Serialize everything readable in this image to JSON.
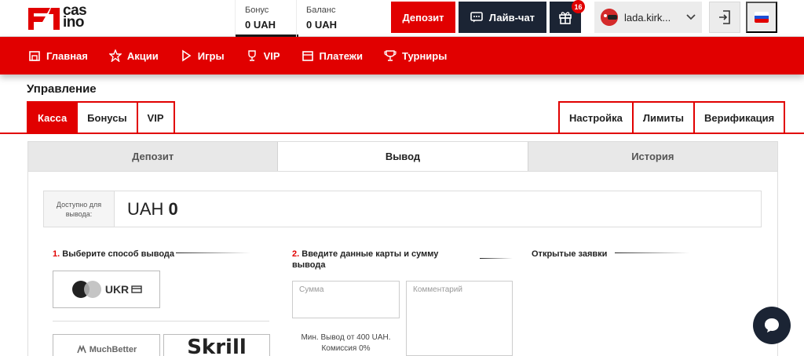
{
  "header": {
    "logo_text": "cas ino",
    "bonus": {
      "label": "Бонус",
      "value": "0 UAH"
    },
    "balance": {
      "label": "Баланс",
      "value": "0 UAH"
    },
    "deposit_label": "Депозит",
    "chat_label": "Лайв-чат",
    "gift_badge": "16",
    "username": "lada.kirk..."
  },
  "nav": {
    "items": [
      {
        "label": "Главная",
        "icon": "home-icon"
      },
      {
        "label": "Акции",
        "icon": "star-icon"
      },
      {
        "label": "Игры",
        "icon": "play-icon"
      },
      {
        "label": "VIP",
        "icon": "trophy-icon"
      },
      {
        "label": "Платежи",
        "icon": "wallet-icon"
      },
      {
        "label": "Турниры",
        "icon": "cup-icon"
      }
    ]
  },
  "management": {
    "title": "Управление",
    "tabs_left": [
      "Касса",
      "Бонусы",
      "VIP"
    ],
    "tabs_right": [
      "Настройка",
      "Лимиты",
      "Верификация"
    ],
    "subtabs": [
      "Депозит",
      "Вывод",
      "История"
    ]
  },
  "withdraw": {
    "available_label": "Доступно для вывода:",
    "currency": "UAH",
    "amount": "0",
    "step1_num": "1.",
    "step1_text": "Выберите способ вывода",
    "step2_num": "2.",
    "step2_text": "Введите данные карты и сумму вывода",
    "open_requests": "Открытые заявки",
    "method_ukr": "UKR",
    "method_muchbetter": "MuchBetter",
    "method_skrill": "Skrill",
    "amount_placeholder": "Сумма",
    "comment_placeholder": "Комментарий",
    "min_note": "Мин. Вывод от 400 UAH.",
    "fee_note": "Комиссия 0%"
  },
  "colors": {
    "brand_red": "#e10000",
    "dark": "#1b2434"
  }
}
